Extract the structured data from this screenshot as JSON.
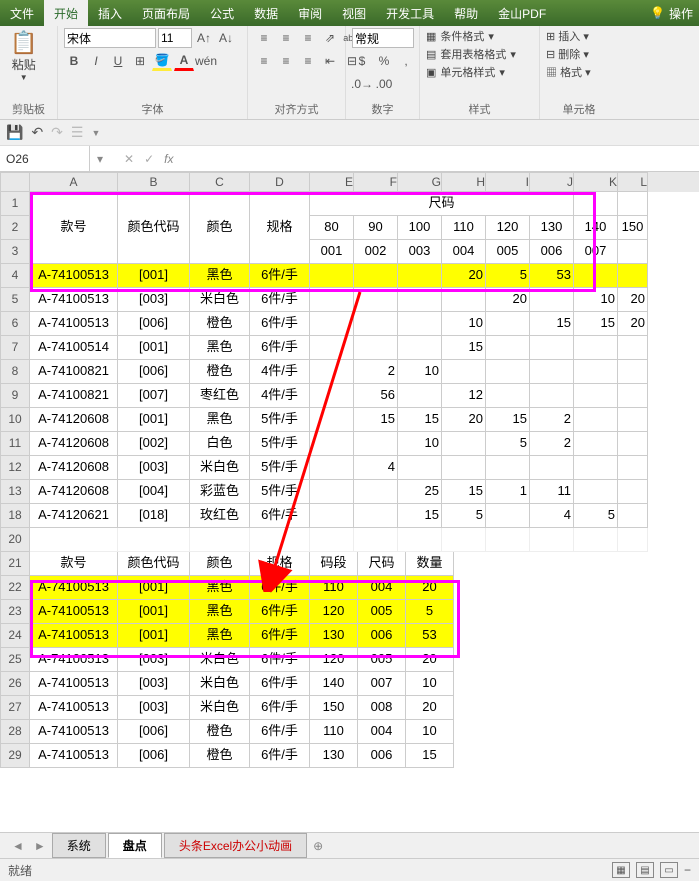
{
  "menu": {
    "items": [
      "文件",
      "开始",
      "插入",
      "页面布局",
      "公式",
      "数据",
      "审阅",
      "视图",
      "开发工具",
      "帮助",
      "金山PDF"
    ],
    "active": "开始",
    "tell": "操作"
  },
  "ribbon": {
    "clipboard": {
      "paste": "粘贴",
      "label": "剪贴板"
    },
    "font": {
      "name": "宋体",
      "size": "11",
      "label": "字体"
    },
    "align": {
      "label": "对齐方式",
      "wrap": "ab"
    },
    "number": {
      "fmt": "常规",
      "label": "数字"
    },
    "styles": {
      "cond": "条件格式",
      "tbl": "套用表格格式",
      "cell": "单元格样式",
      "label": "样式"
    },
    "cells": {
      "ins": "插入",
      "del": "删除",
      "fmt": "格式",
      "label": "单元格"
    }
  },
  "namebox": "O26",
  "top_header": {
    "A": "款号",
    "B": "颜色代码",
    "C": "颜色",
    "D": "规格",
    "size": "尺码",
    "s80": "80",
    "s90": "90",
    "s100": "100",
    "s110": "110",
    "s120": "120",
    "s130": "130",
    "s140": "140",
    "s150": "150",
    "c001": "001",
    "c002": "002",
    "c003": "003",
    "c004": "004",
    "c005": "005",
    "c006": "006",
    "c007": "007"
  },
  "rows_top": [
    {
      "r": "4",
      "y": true,
      "A": "A-74100513",
      "B": "[001]",
      "C": "黑色",
      "D": "6件/手",
      "E": "",
      "F": "",
      "G": "",
      "H": "20",
      "I": "5",
      "J": "53",
      "K": "",
      "L": ""
    },
    {
      "r": "5",
      "A": "A-74100513",
      "B": "[003]",
      "C": "米白色",
      "D": "6件/手",
      "E": "",
      "F": "",
      "G": "",
      "H": "",
      "I": "20",
      "J": "",
      "K": "10",
      "L": "20"
    },
    {
      "r": "6",
      "A": "A-74100513",
      "B": "[006]",
      "C": "橙色",
      "D": "6件/手",
      "E": "",
      "F": "",
      "G": "",
      "H": "10",
      "I": "",
      "J": "15",
      "K": "15",
      "L": "20"
    },
    {
      "r": "7",
      "A": "A-74100514",
      "B": "[001]",
      "C": "黑色",
      "D": "6件/手",
      "E": "",
      "F": "",
      "G": "",
      "H": "15",
      "I": "",
      "J": "",
      "K": "",
      "L": ""
    },
    {
      "r": "8",
      "A": "A-74100821",
      "B": "[006]",
      "C": "橙色",
      "D": "4件/手",
      "E": "",
      "F": "2",
      "G": "10",
      "H": "",
      "I": "",
      "J": "",
      "K": "",
      "L": ""
    },
    {
      "r": "9",
      "A": "A-74100821",
      "B": "[007]",
      "C": "枣红色",
      "D": "4件/手",
      "E": "",
      "F": "56",
      "G": "",
      "H": "12",
      "I": "",
      "J": "",
      "K": "",
      "L": ""
    },
    {
      "r": "10",
      "A": "A-74120608",
      "B": "[001]",
      "C": "黑色",
      "D": "5件/手",
      "E": "",
      "F": "15",
      "G": "15",
      "H": "20",
      "I": "15",
      "J": "2",
      "K": "",
      "L": ""
    },
    {
      "r": "11",
      "A": "A-74120608",
      "B": "[002]",
      "C": "白色",
      "D": "5件/手",
      "E": "",
      "F": "",
      "G": "10",
      "H": "",
      "I": "5",
      "J": "2",
      "K": "",
      "L": ""
    },
    {
      "r": "12",
      "A": "A-74120608",
      "B": "[003]",
      "C": "米白色",
      "D": "5件/手",
      "E": "",
      "F": "4",
      "G": "",
      "H": "",
      "I": "",
      "J": "",
      "K": "",
      "L": ""
    },
    {
      "r": "13",
      "A": "A-74120608",
      "B": "[004]",
      "C": "彩蓝色",
      "D": "5件/手",
      "E": "",
      "F": "",
      "G": "25",
      "H": "15",
      "I": "1",
      "J": "11",
      "K": "",
      "L": ""
    },
    {
      "r": "18",
      "A": "A-74120621",
      "B": "[018]",
      "C": "玫红色",
      "D": "6件/手",
      "E": "",
      "F": "",
      "G": "15",
      "H": "5",
      "I": "",
      "J": "4",
      "K": "5",
      "L": ""
    }
  ],
  "header2": {
    "A": "款号",
    "B": "颜色代码",
    "C": "颜色",
    "D": "规格",
    "E": "码段",
    "F": "尺码",
    "G": "数量"
  },
  "rows_bot": [
    {
      "r": "22",
      "y": true,
      "A": "A-74100513",
      "B": "[001]",
      "C": "黑色",
      "D": "6件/手",
      "E": "110",
      "F": "004",
      "G": "20"
    },
    {
      "r": "23",
      "y": true,
      "A": "A-74100513",
      "B": "[001]",
      "C": "黑色",
      "D": "6件/手",
      "E": "120",
      "F": "005",
      "G": "5"
    },
    {
      "r": "24",
      "y": true,
      "A": "A-74100513",
      "B": "[001]",
      "C": "黑色",
      "D": "6件/手",
      "E": "130",
      "F": "006",
      "G": "53"
    },
    {
      "r": "25",
      "A": "A-74100513",
      "B": "[003]",
      "C": "米白色",
      "D": "6件/手",
      "E": "120",
      "F": "005",
      "G": "20"
    },
    {
      "r": "26",
      "A": "A-74100513",
      "B": "[003]",
      "C": "米白色",
      "D": "6件/手",
      "E": "140",
      "F": "007",
      "G": "10"
    },
    {
      "r": "27",
      "A": "A-74100513",
      "B": "[003]",
      "C": "米白色",
      "D": "6件/手",
      "E": "150",
      "F": "008",
      "G": "20"
    },
    {
      "r": "28",
      "A": "A-74100513",
      "B": "[006]",
      "C": "橙色",
      "D": "6件/手",
      "E": "110",
      "F": "004",
      "G": "10"
    },
    {
      "r": "29",
      "A": "A-74100513",
      "B": "[006]",
      "C": "橙色",
      "D": "6件/手",
      "E": "130",
      "F": "006",
      "G": "15"
    }
  ],
  "tabs": {
    "items": [
      "系统",
      "盘点",
      "头条Excel办公小动画"
    ],
    "active": "盘点"
  },
  "status": {
    "ready": "就绪"
  },
  "cols": [
    "A",
    "B",
    "C",
    "D",
    "E",
    "F",
    "G",
    "H",
    "I",
    "J",
    "K",
    "L"
  ]
}
